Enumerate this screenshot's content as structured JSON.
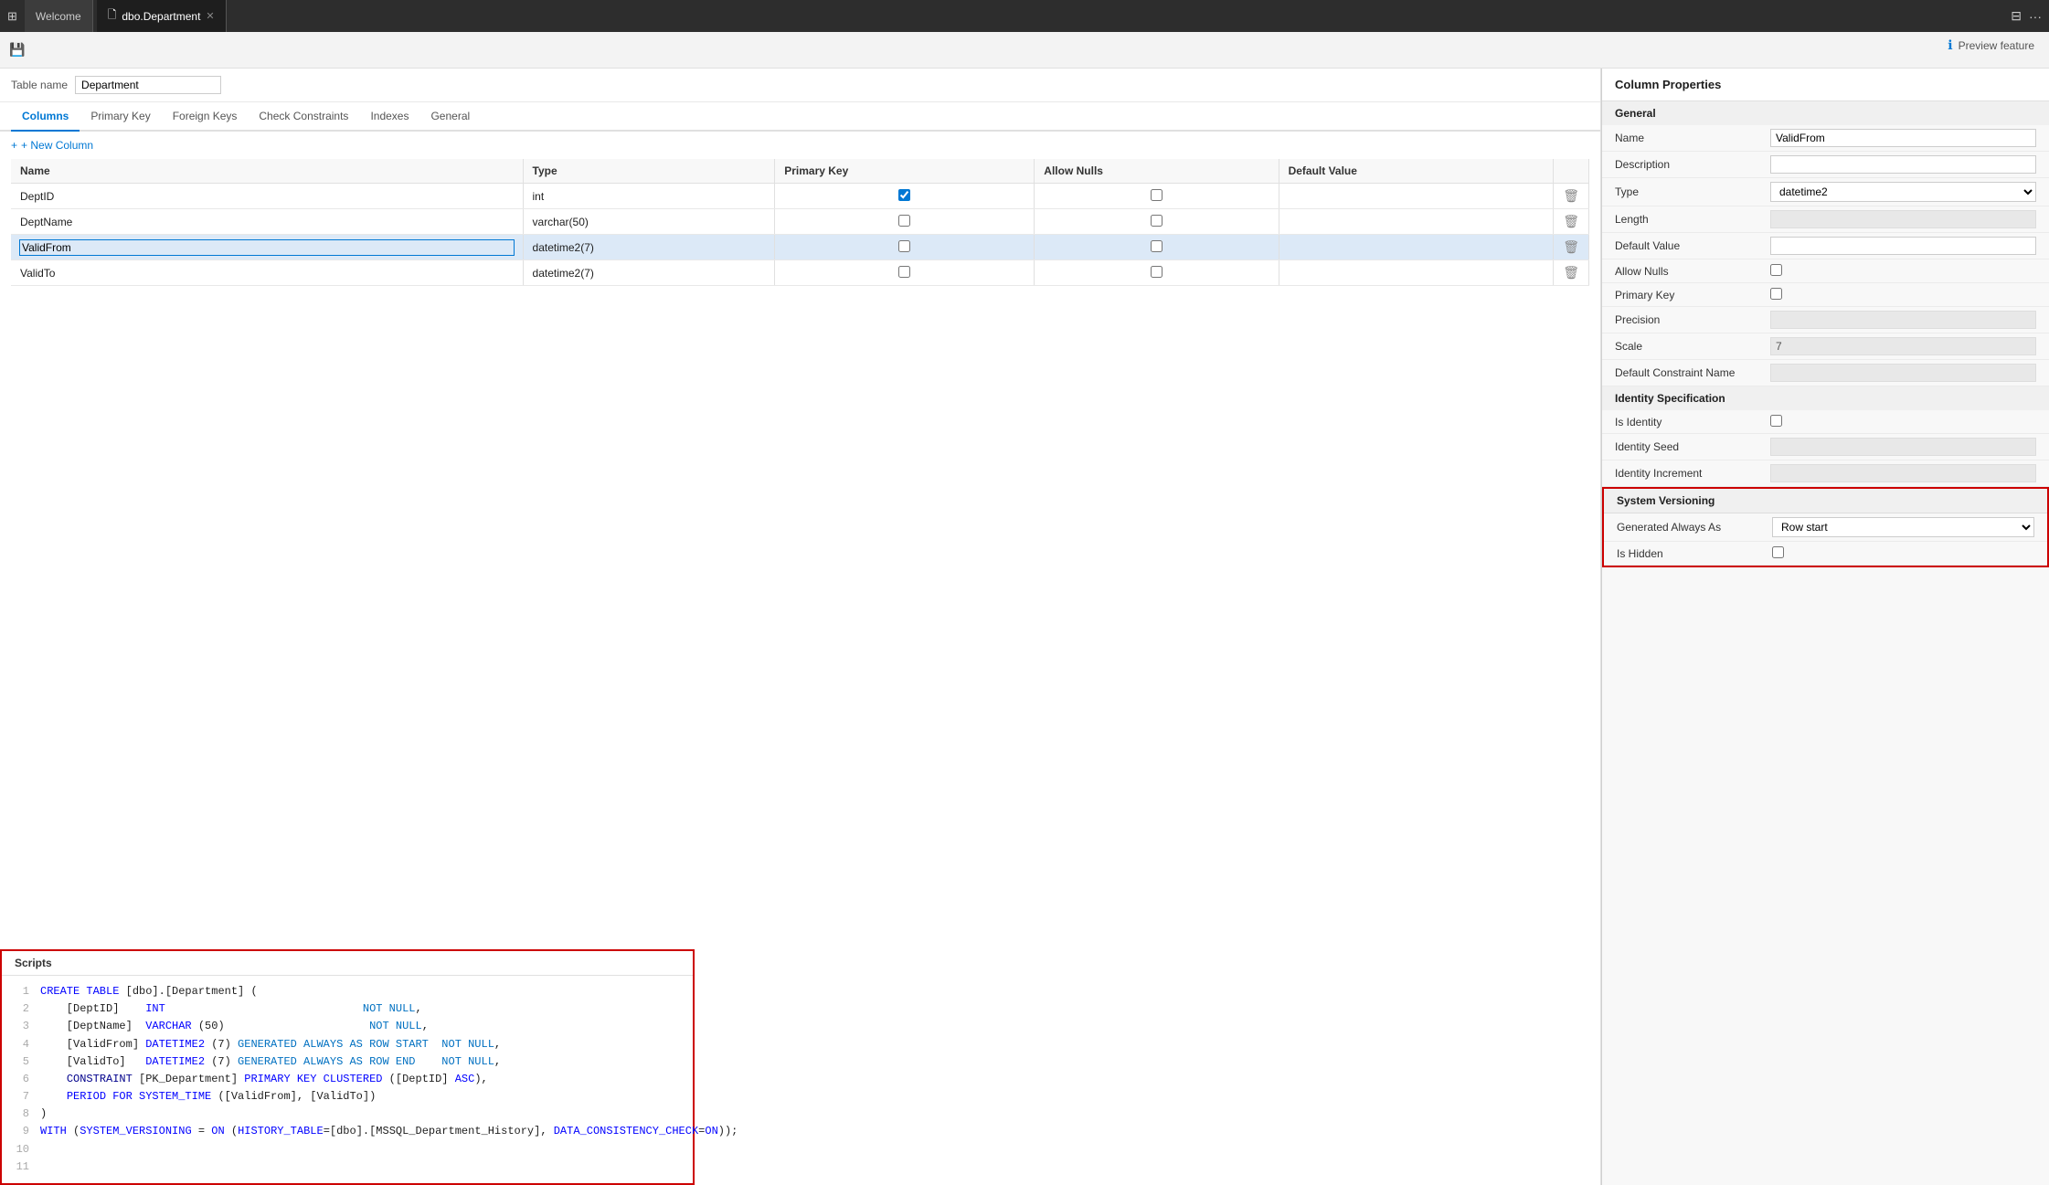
{
  "titlebar": {
    "tabs": [
      {
        "id": "welcome",
        "label": "Welcome",
        "active": false,
        "icon": "⊞"
      },
      {
        "id": "dbo-department",
        "label": "dbo.Department",
        "active": true,
        "icon": "📋"
      }
    ]
  },
  "toolbar": {
    "save_icon": "💾"
  },
  "preview_feature": {
    "label": "Preview feature"
  },
  "table_editor": {
    "table_name_label": "Table name",
    "table_name_value": "Department",
    "tabs": [
      "Columns",
      "Primary Key",
      "Foreign Keys",
      "Check Constraints",
      "Indexes",
      "General"
    ],
    "active_tab": "Columns",
    "new_column_label": "+ New Column",
    "columns_headers": [
      "Name",
      "Type",
      "Primary Key",
      "Allow Nulls",
      "Default Value"
    ],
    "columns": [
      {
        "name": "DeptID",
        "type": "int",
        "primaryKey": true,
        "allowNulls": false,
        "defaultValue": ""
      },
      {
        "name": "DeptName",
        "type": "varchar(50)",
        "primaryKey": false,
        "allowNulls": false,
        "defaultValue": ""
      },
      {
        "name": "ValidFrom",
        "type": "datetime2(7)",
        "primaryKey": false,
        "allowNulls": false,
        "defaultValue": "",
        "selected": true
      },
      {
        "name": "ValidTo",
        "type": "datetime2(7)",
        "primaryKey": false,
        "allowNulls": false,
        "defaultValue": ""
      }
    ]
  },
  "column_properties": {
    "header": "Column Properties",
    "general_section": "General",
    "props": [
      {
        "label": "Name",
        "value": "ValidFrom",
        "type": "input"
      },
      {
        "label": "Description",
        "value": "",
        "type": "input"
      },
      {
        "label": "Type",
        "value": "datetime2",
        "type": "select"
      },
      {
        "label": "Length",
        "value": "",
        "type": "readonly"
      },
      {
        "label": "Default Value",
        "value": "",
        "type": "input"
      },
      {
        "label": "Allow Nulls",
        "value": false,
        "type": "checkbox"
      },
      {
        "label": "Primary Key",
        "value": false,
        "type": "checkbox"
      },
      {
        "label": "Precision",
        "value": "",
        "type": "readonly"
      },
      {
        "label": "Scale",
        "value": "7",
        "type": "readonly"
      },
      {
        "label": "Default Constraint Name",
        "value": "",
        "type": "readonly"
      }
    ],
    "identity_section": "Identity Specification",
    "identity_props": [
      {
        "label": "Is Identity",
        "value": false,
        "type": "checkbox"
      },
      {
        "label": "Identity Seed",
        "value": "",
        "type": "readonly"
      },
      {
        "label": "Identity Increment",
        "value": "",
        "type": "readonly"
      }
    ],
    "system_versioning_section": "System Versioning",
    "system_versioning_props": [
      {
        "label": "Generated Always As",
        "value": "Row start",
        "type": "select_sv"
      },
      {
        "label": "Is Hidden",
        "value": false,
        "type": "checkbox"
      }
    ]
  },
  "scripts": {
    "header": "Scripts",
    "lines": [
      {
        "num": 1,
        "content": "CREATE TABLE [dbo].[Department] ("
      },
      {
        "num": 2,
        "content": "    [DeptID]    INT                              NOT NULL,"
      },
      {
        "num": 3,
        "content": "    [DeptName]  VARCHAR (50)                      NOT NULL,"
      },
      {
        "num": 4,
        "content": "    [ValidFrom] DATETIME2 (7) GENERATED ALWAYS AS ROW START  NOT NULL,"
      },
      {
        "num": 5,
        "content": "    [ValidTo]   DATETIME2 (7) GENERATED ALWAYS AS ROW END    NOT NULL,"
      },
      {
        "num": 6,
        "content": "    CONSTRAINT [PK_Department] PRIMARY KEY CLUSTERED ([DeptID] ASC),"
      },
      {
        "num": 7,
        "content": "    PERIOD FOR SYSTEM_TIME ([ValidFrom], [ValidTo])"
      },
      {
        "num": 8,
        "content": ")"
      },
      {
        "num": 9,
        "content": "WITH (SYSTEM_VERSIONING = ON (HISTORY_TABLE=[dbo].[MSSQL_Department_History], DATA_CONSISTENCY_CHECK=ON));"
      },
      {
        "num": 10,
        "content": ""
      },
      {
        "num": 11,
        "content": ""
      }
    ]
  }
}
